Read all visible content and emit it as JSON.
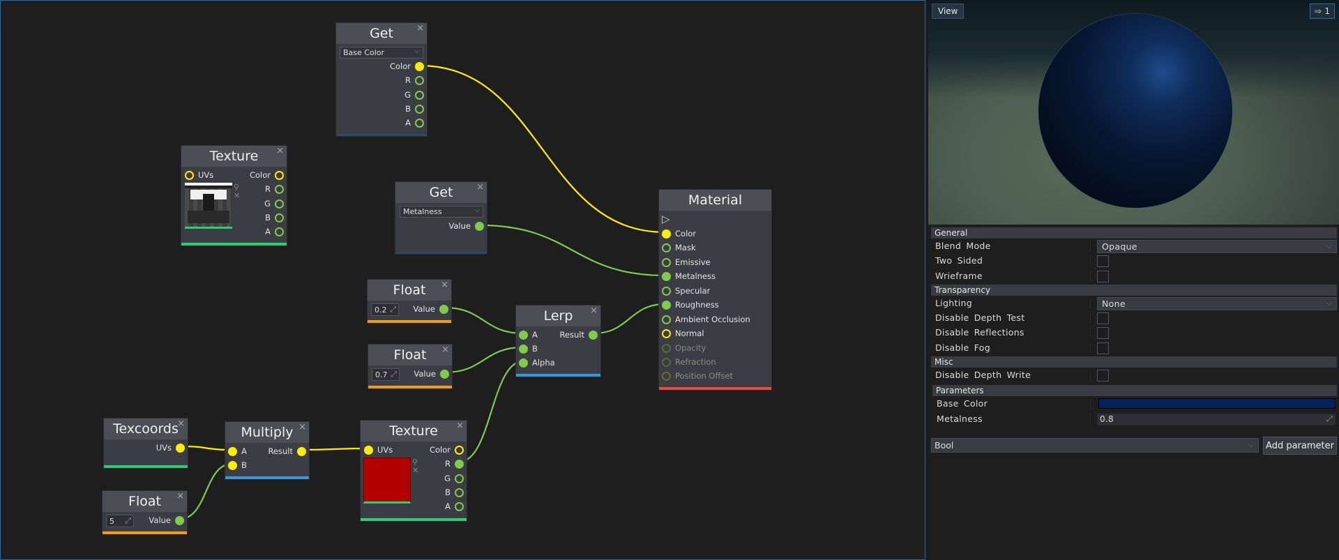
{
  "graph": {
    "nodes": {
      "get_color": {
        "title": "Get",
        "close": "×",
        "selected": "Base Color",
        "chevron": "⌵",
        "outputs": [
          "Color",
          "R",
          "G",
          "B",
          "A"
        ]
      },
      "texture1": {
        "title": "Texture",
        "close": "×",
        "input": "UVs",
        "outputs": [
          "Color",
          "R",
          "G",
          "B",
          "A"
        ],
        "tools": {
          "search": "⚲",
          "remove": "✕"
        }
      },
      "get_metal": {
        "title": "Get",
        "close": "×",
        "selected": "Metalness",
        "chevron": "⌵",
        "outputs": [
          "Value"
        ]
      },
      "float1": {
        "title": "Float",
        "close": "×",
        "value": "0.2",
        "expand": "⤢",
        "output": "Value"
      },
      "float2": {
        "title": "Float",
        "close": "×",
        "value": "0.7",
        "expand": "⤢",
        "output": "Value"
      },
      "lerp": {
        "title": "Lerp",
        "close": "×",
        "inputs": [
          "A",
          "B",
          "Alpha"
        ],
        "output": "Result"
      },
      "material": {
        "title": "Material",
        "exec_icon": "▷",
        "inputs": [
          "Color",
          "Mask",
          "Emissive",
          "Metalness",
          "Specular",
          "Roughness",
          "Ambient Occlusion",
          "Normal",
          "Opacity",
          "Refraction",
          "Position Offset"
        ]
      },
      "texcoords": {
        "title": "Texcoords",
        "close": "×",
        "output": "UVs"
      },
      "multiply": {
        "title": "Multiply",
        "close": "×",
        "inputs": [
          "A",
          "B"
        ],
        "output": "Result"
      },
      "float3": {
        "title": "Float",
        "close": "×",
        "value": "5",
        "expand": "⤢",
        "output": "Value"
      },
      "texture2": {
        "title": "Texture",
        "close": "×",
        "input": "UVs",
        "outputs": [
          "Color",
          "R",
          "G",
          "B",
          "A"
        ],
        "tools": {
          "search": "⚲",
          "remove": "✕"
        }
      }
    },
    "colors": {
      "color_pin": "#ffee00",
      "float_pin": "#7dcc4a",
      "texture_footer": "#2ecc71",
      "float_footer": "#f39c12",
      "math_footer": "#3498db",
      "material_footer": "#e74c3c",
      "get_footer": "#2c4a66"
    }
  },
  "viewport": {
    "view_button": "View",
    "camera_icon": "⇨",
    "camera_count": "1"
  },
  "properties": {
    "sections": {
      "general": "General",
      "transparency": "Transparency",
      "misc": "Misc",
      "parameters": "Parameters"
    },
    "blend_mode": {
      "label": "Blend Mode",
      "value": "Opaque"
    },
    "two_sided": {
      "label": "Two Sided",
      "checked": false
    },
    "wireframe": {
      "label": "Wrieframe",
      "checked": false
    },
    "lighting": {
      "label": "Lighting",
      "value": "None"
    },
    "disable_depth_test": {
      "label": "Disable Depth Test",
      "checked": false
    },
    "disable_reflections": {
      "label": "Disable Reflections",
      "checked": false
    },
    "disable_fog": {
      "label": "Disable Fog",
      "checked": false
    },
    "disable_depth_write": {
      "label": "Disable Depth Write",
      "checked": false
    },
    "base_color": {
      "label": "Base Color",
      "value": "#06225a"
    },
    "metalness": {
      "label": "Metalness",
      "value": "0.8",
      "expand": "⤢"
    },
    "chevron": "⌵"
  },
  "add_parameter": {
    "type": "Bool",
    "chevron": "⌵",
    "button": "Add parameter"
  }
}
